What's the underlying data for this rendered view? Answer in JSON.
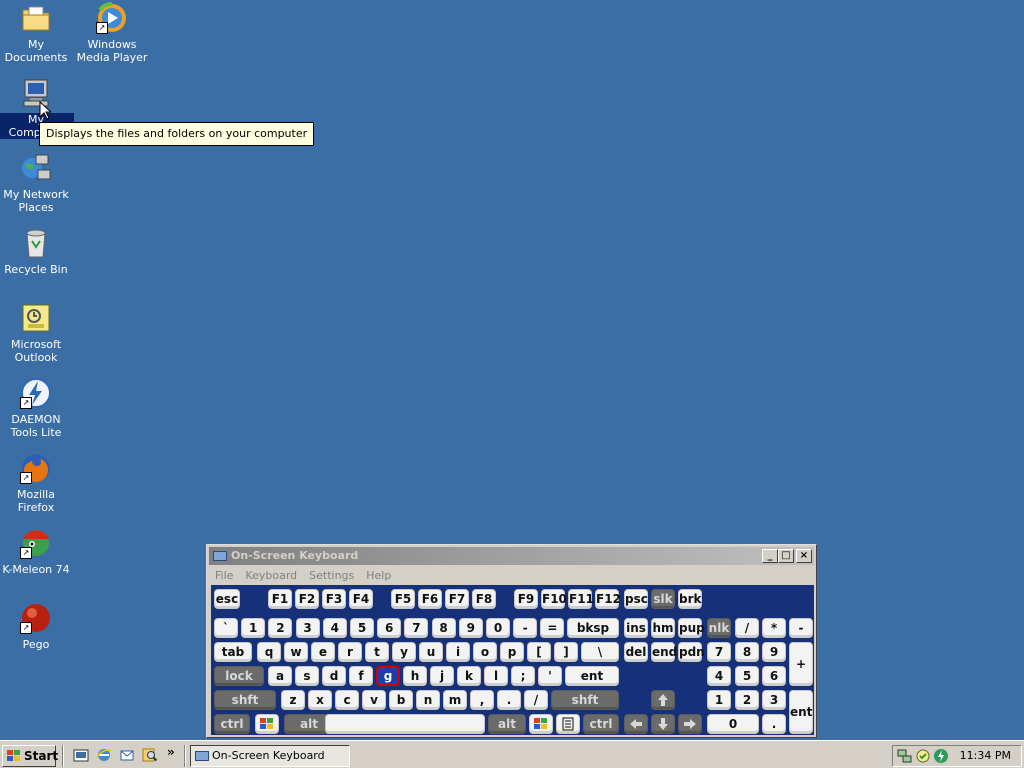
{
  "desktop": {
    "icons": [
      {
        "label": "My Documents",
        "icon": "folder-documents-icon"
      },
      {
        "label": "Windows Media Player",
        "icon": "media-player-icon"
      },
      {
        "label": "My Computer",
        "icon": "computer-icon"
      },
      {
        "label": "My Network Places",
        "icon": "network-places-icon"
      },
      {
        "label": "Recycle Bin",
        "icon": "recycle-bin-icon"
      },
      {
        "label": "Microsoft Outlook",
        "icon": "outlook-icon"
      },
      {
        "label": "DAEMON Tools Lite",
        "icon": "daemon-tools-icon"
      },
      {
        "label": "Mozilla Firefox",
        "icon": "firefox-icon"
      },
      {
        "label": "K-Meleon 74",
        "icon": "kmeleon-icon"
      },
      {
        "label": "Pego",
        "icon": "pego-icon"
      }
    ],
    "tooltip": "Displays the files and folders on your computer"
  },
  "osk": {
    "title": "On-Screen Keyboard",
    "menu": [
      "File",
      "Keyboard",
      "Settings",
      "Help"
    ],
    "highlighted_key": "g",
    "rows": {
      "fn": [
        "esc",
        "F1",
        "F2",
        "F3",
        "F4",
        "F5",
        "F6",
        "F7",
        "F8",
        "F9",
        "F10",
        "F11",
        "F12",
        "psc",
        "slk",
        "brk"
      ],
      "num": [
        "`",
        "1",
        "2",
        "3",
        "4",
        "5",
        "6",
        "7",
        "8",
        "9",
        "0",
        "-",
        "=",
        "bksp",
        "ins",
        "hm",
        "pup",
        "nlk",
        "/",
        "*",
        "-"
      ],
      "tab": [
        "tab",
        "q",
        "w",
        "e",
        "r",
        "t",
        "y",
        "u",
        "i",
        "o",
        "p",
        "[",
        "]",
        "\\",
        "del",
        "end",
        "pdn",
        "7",
        "8",
        "9",
        "+"
      ],
      "caps": [
        "lock",
        "a",
        "s",
        "d",
        "f",
        "g",
        "h",
        "j",
        "k",
        "l",
        ";",
        "'",
        "ent",
        "4",
        "5",
        "6"
      ],
      "shift": [
        "shft",
        "z",
        "x",
        "c",
        "v",
        "b",
        "n",
        "m",
        ",",
        ".",
        "/",
        "shft",
        "1",
        "2",
        "3",
        "ent"
      ],
      "bottom": [
        "ctrl",
        "alt",
        "alt",
        "ctrl",
        "0",
        "."
      ]
    }
  },
  "taskbar": {
    "start_label": "Start",
    "task_label": "On-Screen Keyboard",
    "clock": "11:34 PM",
    "chevron": "»"
  },
  "colors": {
    "desktop": "#3a6ea5",
    "keyboard_bg": "#16307a",
    "highlight_border": "#d40000"
  }
}
